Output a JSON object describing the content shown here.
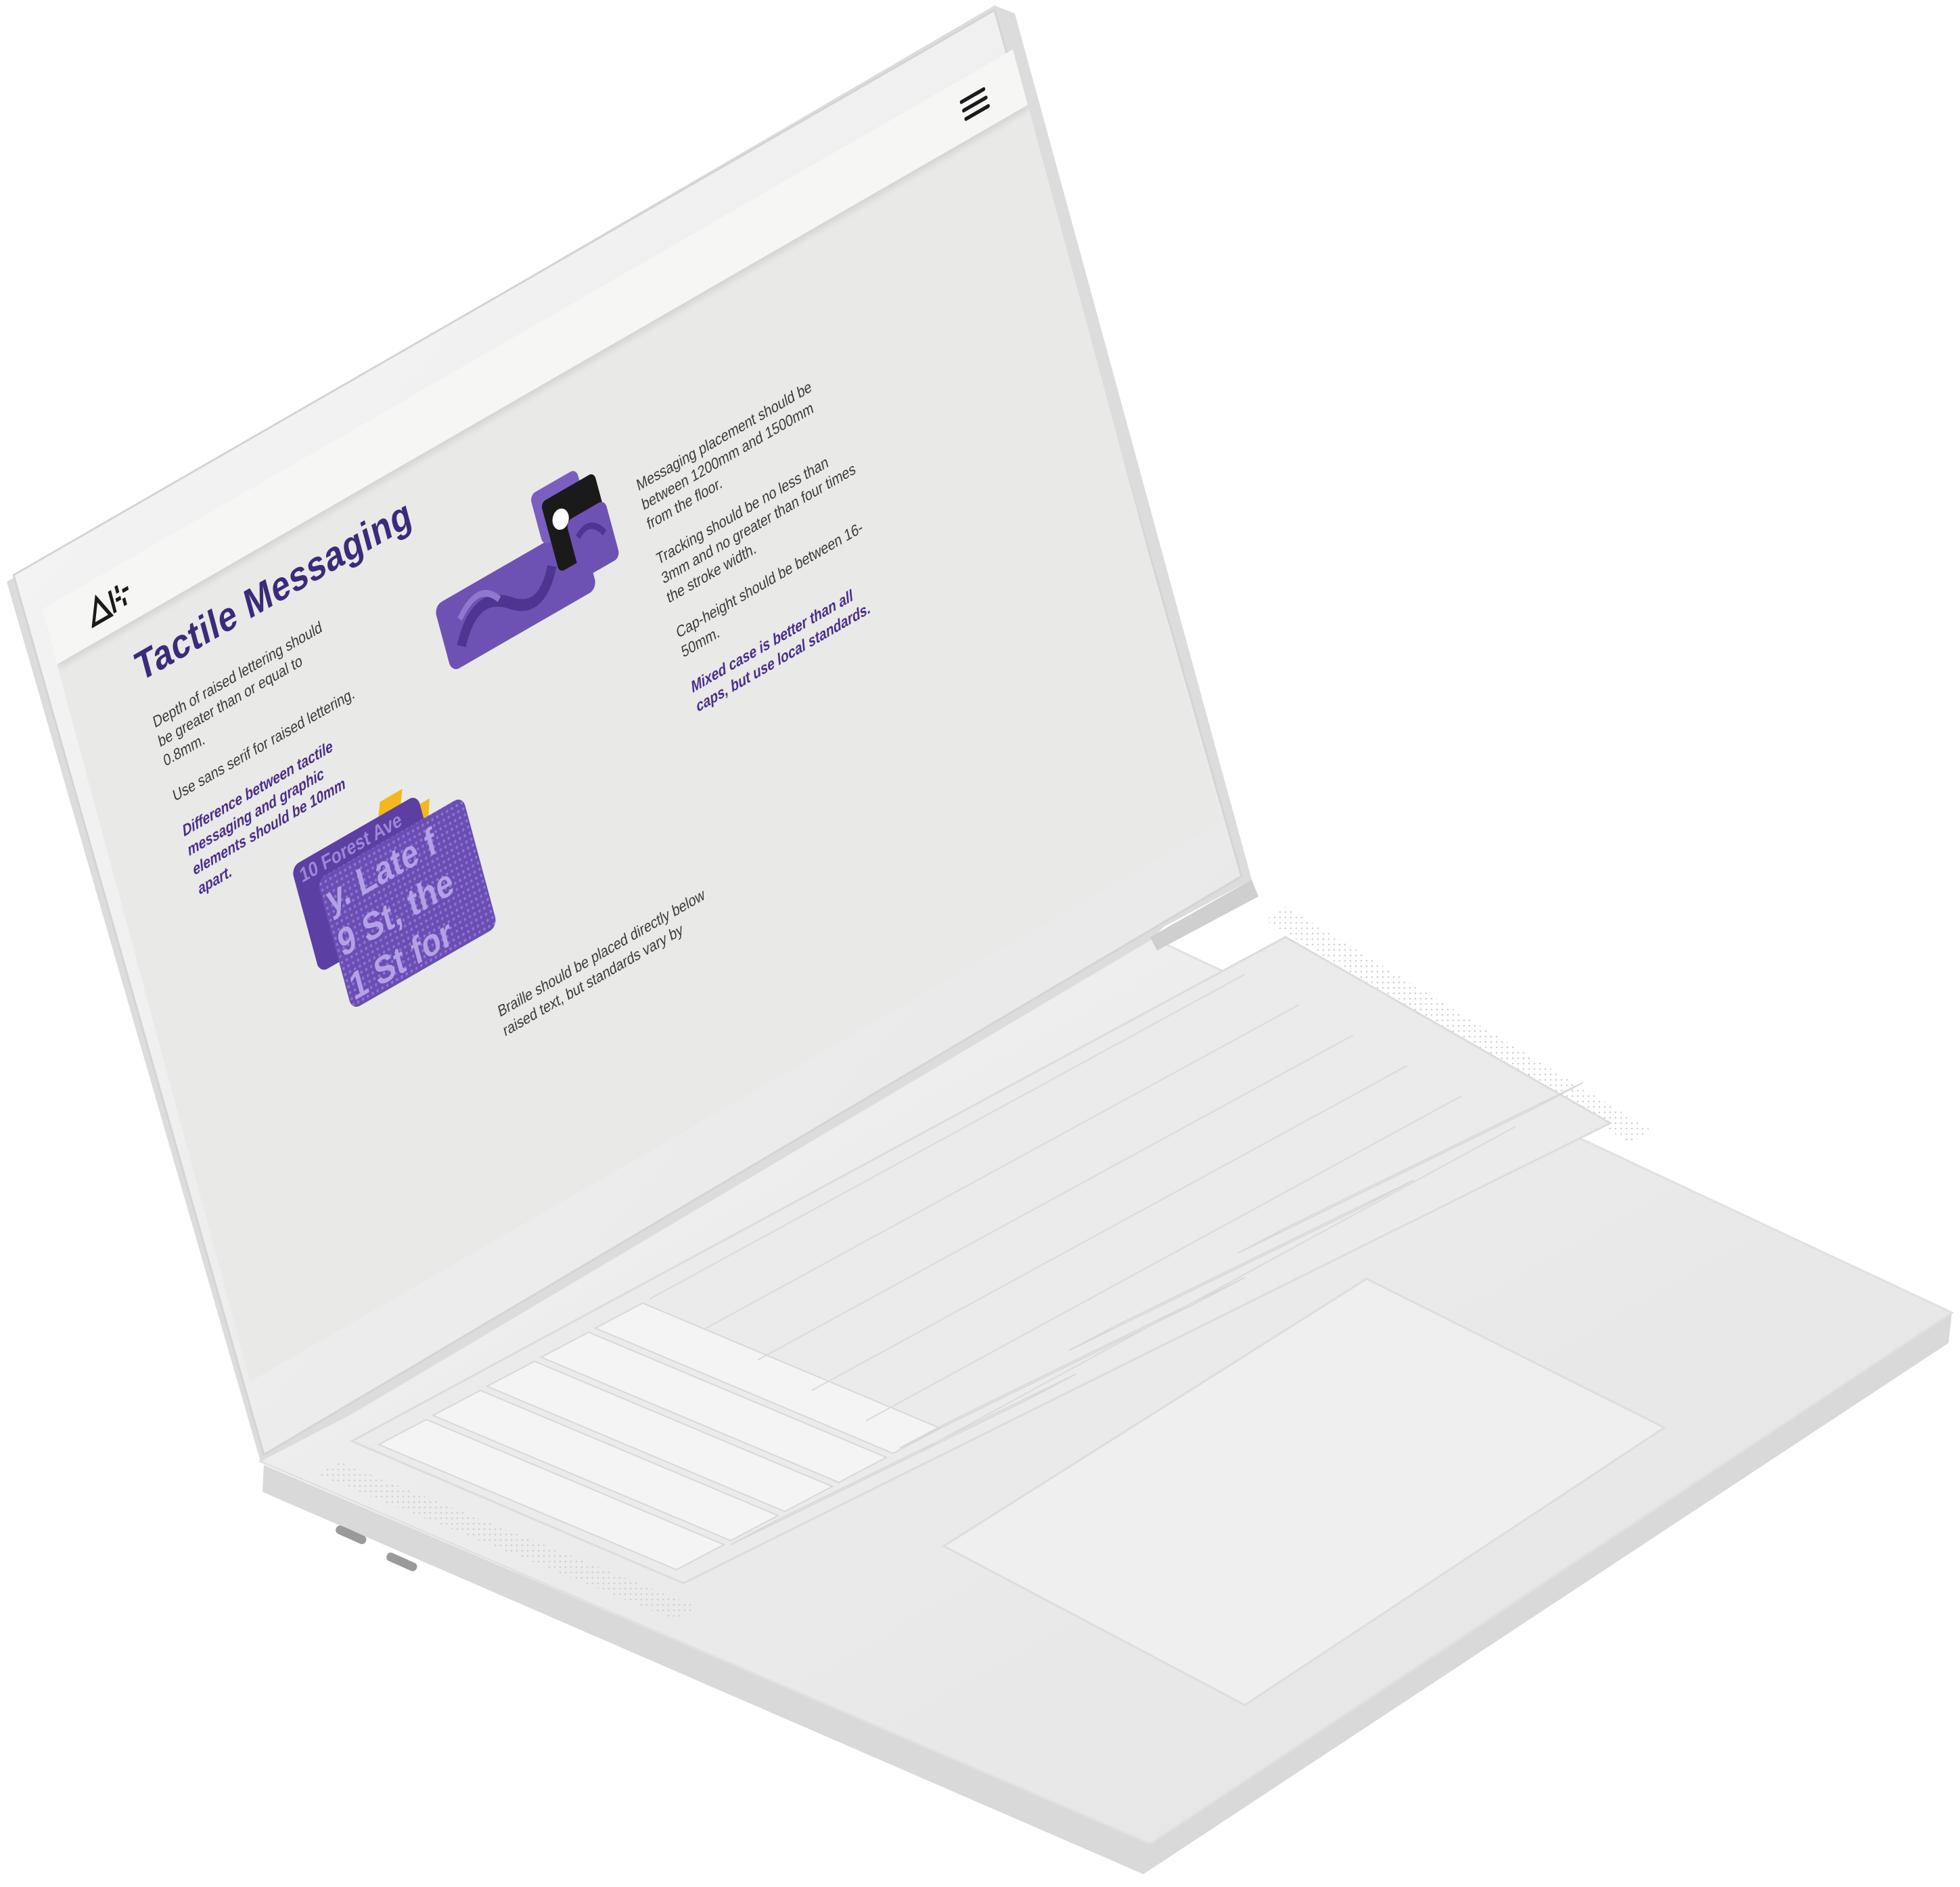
{
  "header": {
    "logo_icon": "brand-logo-icon",
    "menu_icon": "hamburger-menu-icon"
  },
  "page": {
    "title": "Tactile Messaging",
    "left_column": [
      "Depth of raised lettering should be greater than or equal to 0.8mm.",
      "Use sans serif for raised lettering."
    ],
    "left_emphasis": "Difference between tactile messaging and graphic elements should be 10mm apart.",
    "right_column": [
      "Messaging placement should be between 1200mm and 1500mm from the floor.",
      "Tracking should be no less than 3mm and no greater than four times the stroke width.",
      "Cap-height should be between 16-50mm."
    ],
    "right_emphasis": "Mixed case is better than all caps, but use local standards.",
    "braille_caption": "Braille should be placed directly below raised text, but standards vary by"
  },
  "braille_sample": {
    "lines": [
      "10 Forest Ave",
      "y. Late f",
      "9 St, the",
      "1 St for"
    ]
  },
  "colors": {
    "brand_purple": "#4a2c8c",
    "title_purple": "#3c2a7a",
    "image_purple": "#6e52b3",
    "accent_yellow": "#f5b81c",
    "screen_bg": "#e9e9e7"
  }
}
